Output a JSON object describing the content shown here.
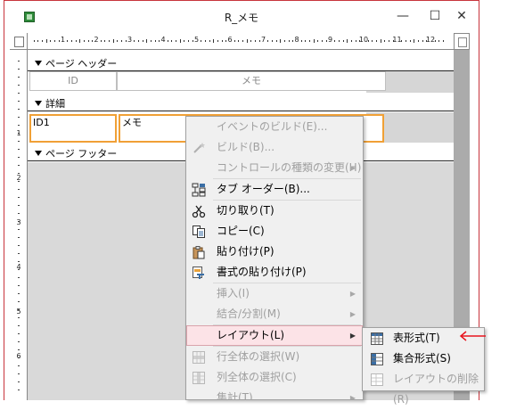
{
  "window": {
    "title": "R_メモ",
    "minimize_glyph": "—",
    "maximize_glyph": "☐",
    "close_glyph": "✕"
  },
  "ruler": {
    "marks": [
      "1",
      "2",
      "3",
      "4",
      "5",
      "6",
      "7",
      "8",
      "9",
      "10",
      "11",
      "12"
    ],
    "vertical_marks": [
      "1",
      "2",
      "3",
      "4",
      "5",
      "6",
      "7"
    ]
  },
  "sections": {
    "page_header": "ページ ヘッダー",
    "detail": "詳細",
    "page_footer": "ページ フッター"
  },
  "header_labels": {
    "id": "ID",
    "memo": "メモ"
  },
  "detail_controls": {
    "id": "ID1",
    "memo": "メモ"
  },
  "context_menu": [
    {
      "label": "イベントのビルド(E)...",
      "enabled": false,
      "icon": "",
      "submenu": false
    },
    {
      "label": "ビルド(B)...",
      "enabled": false,
      "icon": "build-wand-icon",
      "submenu": false
    },
    {
      "label": "コントロールの種類の変更(H)",
      "enabled": false,
      "icon": "",
      "submenu": true
    },
    {
      "label": "タブ オーダー(B)...",
      "enabled": true,
      "icon": "tab-order-icon",
      "submenu": false
    },
    {
      "label": "切り取り(T)",
      "enabled": true,
      "icon": "scissors-icon",
      "submenu": false
    },
    {
      "label": "コピー(C)",
      "enabled": true,
      "icon": "copy-icon",
      "submenu": false
    },
    {
      "label": "貼り付け(P)",
      "enabled": true,
      "icon": "paste-icon",
      "submenu": false
    },
    {
      "label": "書式の貼り付け(P)",
      "enabled": true,
      "icon": "format-painter-icon",
      "submenu": false
    },
    {
      "label": "挿入(I)",
      "enabled": false,
      "icon": "",
      "submenu": true
    },
    {
      "label": "結合/分割(M)",
      "enabled": false,
      "icon": "",
      "submenu": true
    },
    {
      "label": "レイアウト(L)",
      "enabled": true,
      "icon": "",
      "submenu": true,
      "highlighted": true
    },
    {
      "label": "行全体の選択(W)",
      "enabled": false,
      "icon": "select-row-icon",
      "submenu": false
    },
    {
      "label": "列全体の選択(C)",
      "enabled": false,
      "icon": "select-column-icon",
      "submenu": false
    },
    {
      "label": "集計(T)",
      "enabled": false,
      "icon": "",
      "submenu": true
    }
  ],
  "layout_submenu": [
    {
      "label": "表形式(T)",
      "enabled": true,
      "icon": "tabular-layout-icon"
    },
    {
      "label": "集合形式(S)",
      "enabled": true,
      "icon": "stacked-layout-icon"
    },
    {
      "label": "レイアウトの削除(R)",
      "enabled": false,
      "icon": "remove-layout-icon"
    }
  ],
  "colors": {
    "selection_border": "#f0a036",
    "menu_highlight": "#fce3e7",
    "annotation_arrow": "#e8141e",
    "window_border": "#c8343c"
  }
}
